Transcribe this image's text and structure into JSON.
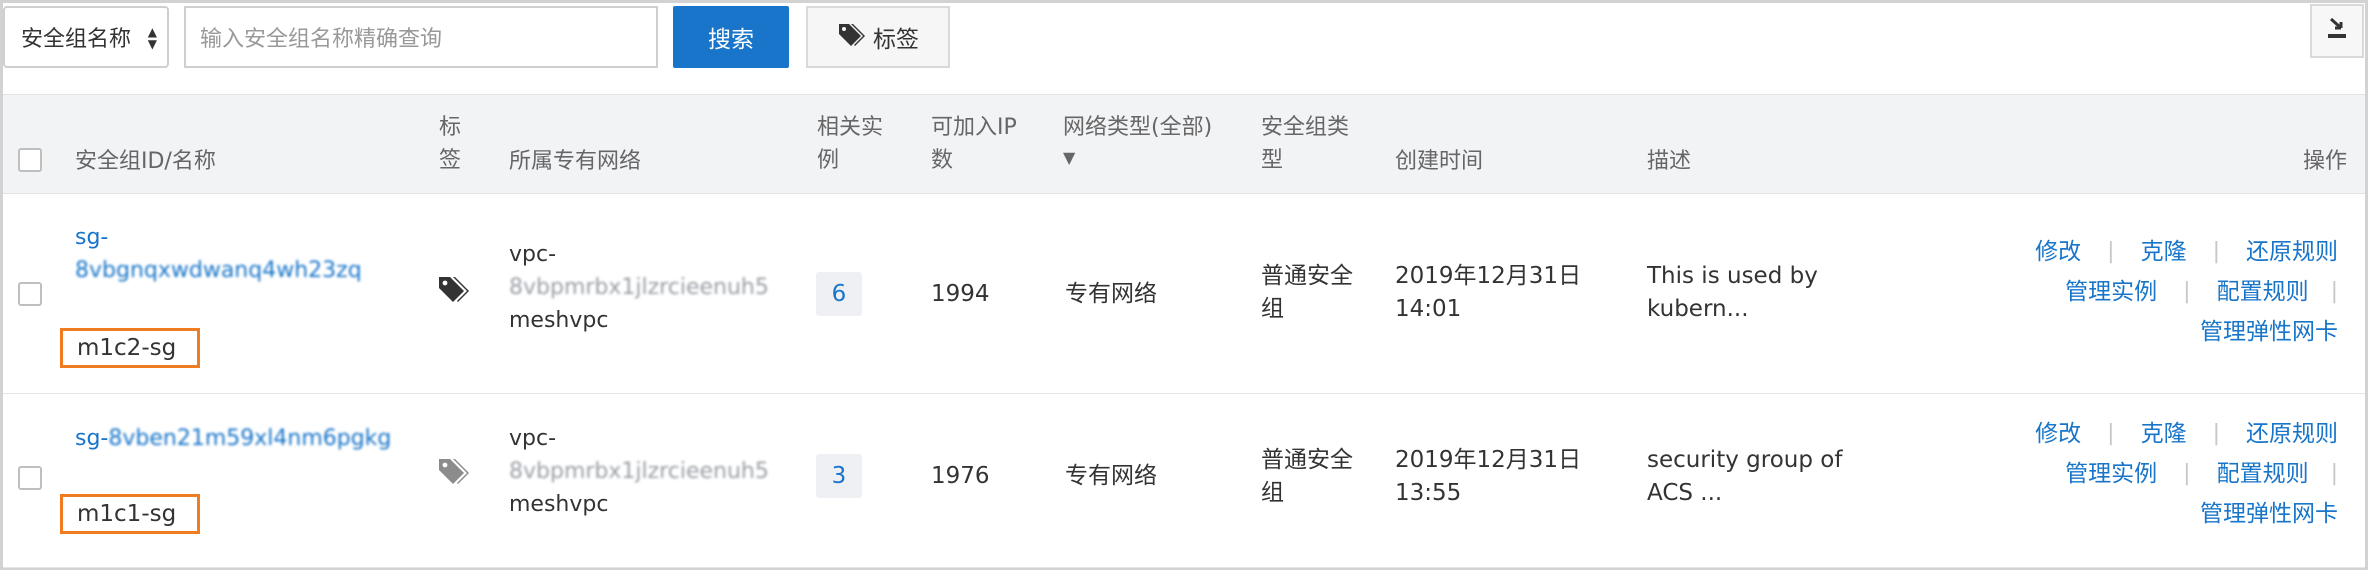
{
  "toolbar": {
    "filter_select": "安全组名称",
    "search_placeholder": "输入安全组名称精确查询",
    "search_button": "搜索",
    "tag_button": "标签"
  },
  "table": {
    "headers": {
      "id_name": "安全组ID/名称",
      "tag_line1": "标",
      "tag_line2": "签",
      "vpc": "所属专有网络",
      "instances_line1": "相关实",
      "instances_line2": "例",
      "ip_line1": "可加入IP",
      "ip_line2": "数",
      "network_type": "网络类型(全部)",
      "sg_type_line1": "安全组类",
      "sg_type_line2": "型",
      "created": "创建时间",
      "description": "描述",
      "actions": "操作"
    },
    "rows": [
      {
        "id_line1": "sg-",
        "id_line2": "8vbgnqxwdwanq4wh23zq",
        "name": "m1c2-sg",
        "vpc_line1": "vpc-",
        "vpc_line2": "8vbpmrbx1jlzrcieenuh5",
        "vpc_line3": "meshvpc",
        "instances": "6",
        "available_ips": "1994",
        "network_type": "专有网络",
        "sg_type_line1": "普通安全",
        "sg_type_line2": "组",
        "created_line1": "2019年12月31日",
        "created_line2": "14:01",
        "desc_line1": "This is used by",
        "desc_line2": "kubern...",
        "actions": {
          "modify": "修改",
          "clone": "克隆",
          "restore": "还原规则",
          "manage_instances": "管理实例",
          "configure_rules": "配置规则",
          "manage_eni": "管理弹性网卡"
        }
      },
      {
        "id_prefix": "sg-",
        "id_rest": "8vben21m59xl4nm6pgkg",
        "name": "m1c1-sg",
        "vpc_line1": "vpc-",
        "vpc_line2": "8vbpmrbx1jlzrcieenuh5",
        "vpc_line3": "meshvpc",
        "instances": "3",
        "available_ips": "1976",
        "network_type": "专有网络",
        "sg_type_line1": "普通安全",
        "sg_type_line2": "组",
        "created_line1": "2019年12月31日",
        "created_line2": "13:55",
        "desc_line1": "security group of",
        "desc_line2": "ACS ...",
        "actions": {
          "modify": "修改",
          "clone": "克隆",
          "restore": "还原规则",
          "manage_instances": "管理实例",
          "configure_rules": "配置规则",
          "manage_eni": "管理弹性网卡"
        }
      }
    ]
  },
  "icons": {
    "tag": "tag-icon",
    "tags": "tags-icon",
    "export": "export-icon",
    "sort": "sort-caret-icon",
    "filter": "filter-caret-icon"
  },
  "colors": {
    "primary": "#1875c9",
    "highlight_box": "#f07c21",
    "header_bg": "#f2f3f5"
  }
}
